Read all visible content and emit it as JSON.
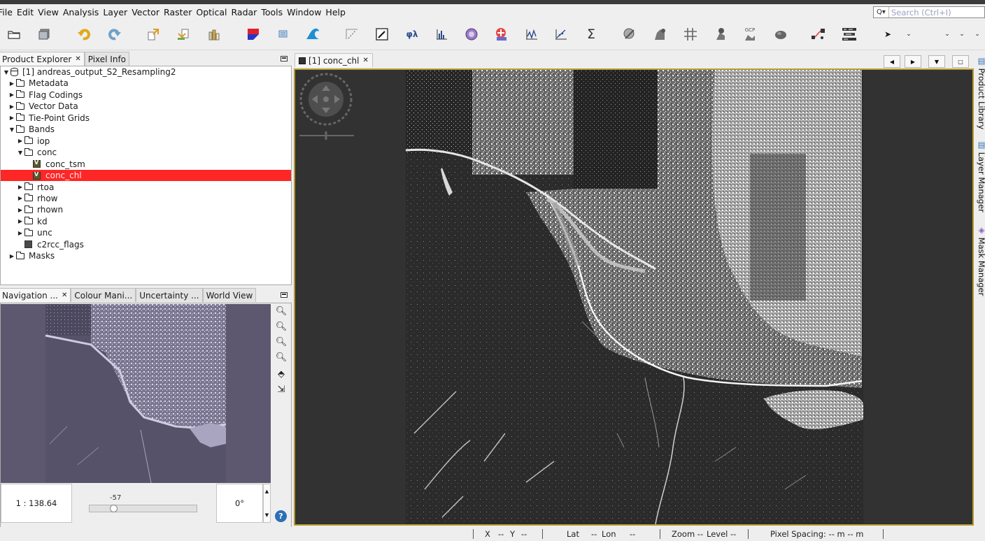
{
  "menu": [
    "File",
    "Edit",
    "View",
    "Analysis",
    "Layer",
    "Vector",
    "Raster",
    "Optical",
    "Radar",
    "Tools",
    "Window",
    "Help"
  ],
  "search": {
    "placeholder": "Search (Ctrl+I)"
  },
  "toolbar": {
    "icons": [
      "open-product-icon",
      "save-product-icon",
      "undo-icon",
      "redo-icon",
      "export-icon",
      "import-icon",
      "bands-icon",
      "rgb-icon",
      "graph-icon",
      "wave-icon",
      "pin-icon",
      "edit-icon",
      "spectrum-icon",
      "histogram-icon",
      "info-icon",
      "analysis-icon",
      "profile-icon",
      "scatter-icon",
      "sum-icon",
      "mask-icon",
      "vector-icon",
      "grid-icon",
      "pin-manager-icon",
      "gcp-icon",
      "blob-icon",
      "graph-builder-icon",
      "batch-icon",
      "select-tool-icon",
      "more-icon"
    ],
    "labels": {
      "phi_lambda": "φλ",
      "sigma": "Σ",
      "gcp": "GCP"
    }
  },
  "product_explorer": {
    "tabs": [
      "Product Explorer",
      "Pixel Info"
    ],
    "tree": [
      {
        "label": "[1] andreas_output_S2_Resampling2",
        "level": 0,
        "type": "product",
        "expanded": true
      },
      {
        "label": "Metadata",
        "level": 1,
        "type": "folder",
        "expanded": false
      },
      {
        "label": "Flag Codings",
        "level": 1,
        "type": "folder",
        "expanded": false
      },
      {
        "label": "Vector Data",
        "level": 1,
        "type": "folder",
        "expanded": false
      },
      {
        "label": "Tie-Point Grids",
        "level": 1,
        "type": "folder",
        "expanded": false
      },
      {
        "label": "Bands",
        "level": 1,
        "type": "folder",
        "expanded": true
      },
      {
        "label": "iop",
        "level": 2,
        "type": "folder",
        "expanded": false
      },
      {
        "label": "conc",
        "level": 2,
        "type": "folder",
        "expanded": true
      },
      {
        "label": "conc_tsm",
        "level": 3,
        "type": "band"
      },
      {
        "label": "conc_chl",
        "level": 3,
        "type": "band",
        "selected": true
      },
      {
        "label": "rtoa",
        "level": 2,
        "type": "folder",
        "expanded": false
      },
      {
        "label": "rhow",
        "level": 2,
        "type": "folder",
        "expanded": false
      },
      {
        "label": "rhown",
        "level": 2,
        "type": "folder",
        "expanded": false
      },
      {
        "label": "kd",
        "level": 2,
        "type": "folder",
        "expanded": false
      },
      {
        "label": "unc",
        "level": 2,
        "type": "folder",
        "expanded": false
      },
      {
        "label": "c2rcc_flags",
        "level": 2,
        "type": "flag"
      },
      {
        "label": "Masks",
        "level": 1,
        "type": "folder",
        "expanded": false
      }
    ]
  },
  "nav_panel": {
    "tabs": [
      "Navigation ...",
      "Colour Mani...",
      "Uncertainty ...",
      "World View"
    ],
    "scale": "1 : 138.64",
    "slider_label": "-57",
    "angle": "0°"
  },
  "document": {
    "tab_label": "[1] conc_chl"
  },
  "right_panels": [
    "Product Library",
    "Layer Manager",
    "Mask Manager"
  ],
  "status": {
    "x_label": "X",
    "x_val": "--",
    "y_label": "Y",
    "y_val": "--",
    "lat_label": "Lat",
    "lat_val": "--",
    "lon_label": "Lon",
    "lon_val": "--",
    "zoom": "Zoom --",
    "level": "Level --",
    "pixel_spacing": "Pixel Spacing: -- m -- m"
  },
  "colors": {
    "selection": "#ff2626",
    "image_border": "#b79b2f",
    "nav_bg": "#5d586f",
    "image_bg": "#323232"
  }
}
